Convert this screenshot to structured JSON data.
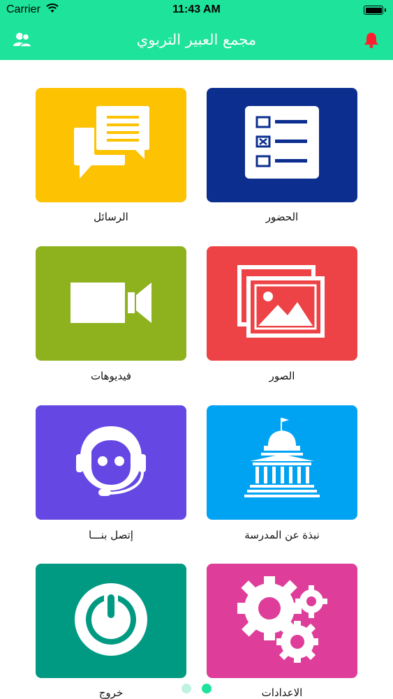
{
  "status_bar": {
    "carrier": "Carrier",
    "time": "11:43 AM"
  },
  "header": {
    "title": "مجمع العبير التربوي",
    "left_icon": "users-icon",
    "right_icon": "bell-icon",
    "color": "#1ee39b"
  },
  "tiles": [
    {
      "label": "الحضور",
      "icon": "attendance-checklist-icon",
      "color": "#0b2e8f"
    },
    {
      "label": "الرسائل",
      "icon": "chat-bubbles-icon",
      "color": "#fdc201"
    },
    {
      "label": "الصور",
      "icon": "images-icon",
      "color": "#ee4346"
    },
    {
      "label": "فيديوهات",
      "icon": "video-camera-icon",
      "color": "#8eb11e"
    },
    {
      "label": "نبذة عن المدرسة",
      "icon": "school-building-icon",
      "color": "#00a3f2"
    },
    {
      "label": "إتصل بنـــا",
      "icon": "support-headset-icon",
      "color": "#6548e4"
    },
    {
      "label": "الاعدادات",
      "icon": "gears-icon",
      "color": "#de3d9a"
    },
    {
      "label": "خروج",
      "icon": "power-icon",
      "color": "#009a83"
    }
  ],
  "pager": {
    "pages": 2,
    "current": 2,
    "dot_inactive": "#bff3e0",
    "dot_active": "#1ee39b"
  }
}
